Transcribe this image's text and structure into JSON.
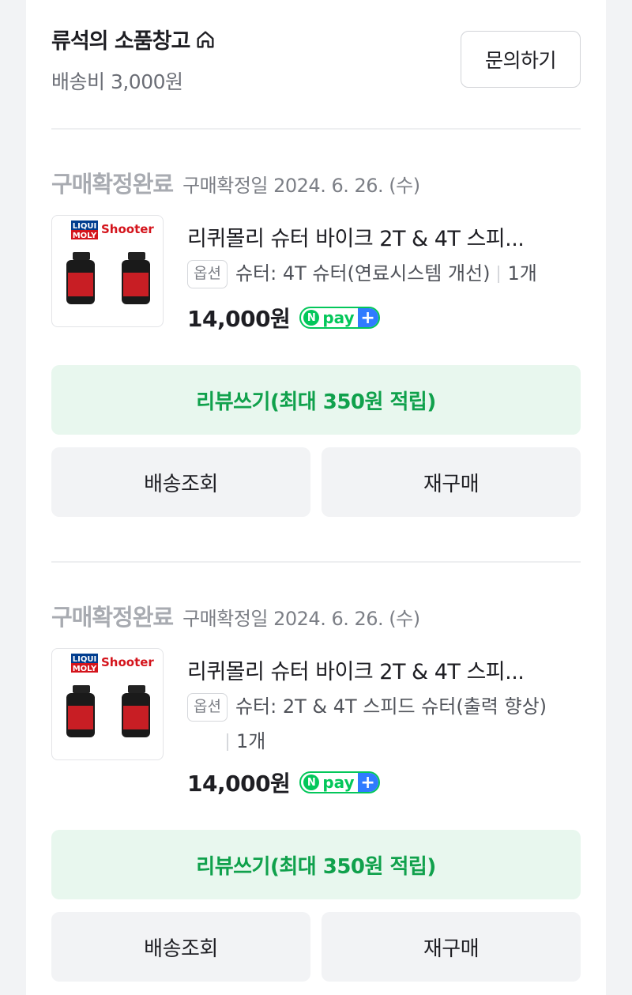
{
  "seller": {
    "name": "류석의 소품창고",
    "shipping_fee": "배송비 3,000원",
    "inquiry_label": "문의하기"
  },
  "orders": [
    {
      "status": "구매확정완료",
      "date": "구매확정일 2024. 6. 26. (수)",
      "product_name": "리퀴몰리 슈터 바이크 2T & 4T 스피...",
      "thumb_brand_1": "LIQUI",
      "thumb_brand_2": "MOLY",
      "thumb_shooter": "Shooter",
      "option_badge": "옵션",
      "option_text": "슈터: 4T 슈터(연료시스템 개선)",
      "quantity": "1개",
      "price": "14,000원",
      "npay_n": "N",
      "npay_text": "pay",
      "npay_plus": "+",
      "review_label": "리뷰쓰기(최대 350원 적립)",
      "track_label": "배송조회",
      "rebuy_label": "재구매"
    },
    {
      "status": "구매확정완료",
      "date": "구매확정일 2024. 6. 26. (수)",
      "product_name": "리퀴몰리 슈터 바이크 2T & 4T 스피...",
      "thumb_brand_1": "LIQUI",
      "thumb_brand_2": "MOLY",
      "thumb_shooter": "Shooter",
      "option_badge": "옵션",
      "option_text": "슈터: 2T & 4T 스피드 슈터(출력 향상)",
      "quantity": "1개",
      "price": "14,000원",
      "npay_n": "N",
      "npay_text": "pay",
      "npay_plus": "+",
      "review_label": "리뷰쓰기(최대 350원 적립)",
      "track_label": "배송조회",
      "rebuy_label": "재구매"
    }
  ],
  "colors": {
    "accent_green": "#10a14c",
    "review_bg": "#e8f7ee",
    "status_gray": "#a8abb1",
    "npay_green": "#03c75a",
    "npay_blue": "#2f7bff"
  }
}
